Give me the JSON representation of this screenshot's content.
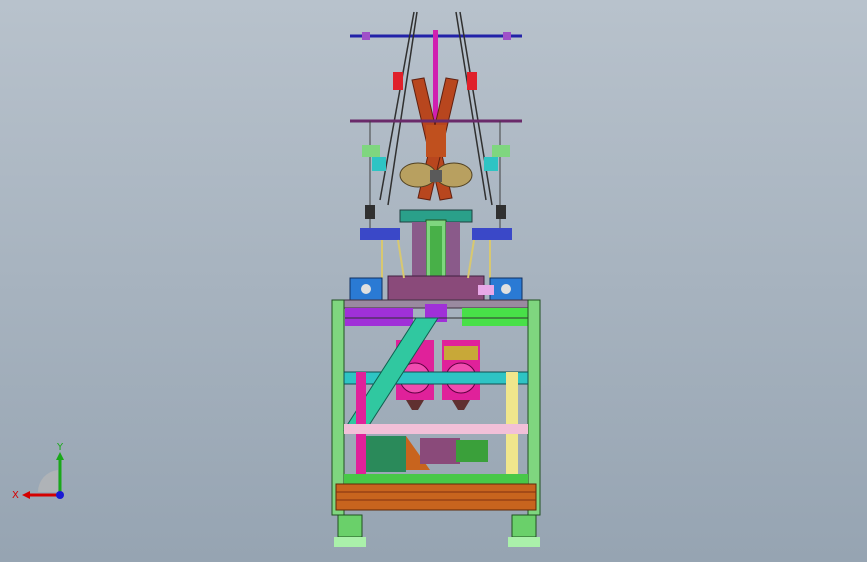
{
  "triad": {
    "x_label": "X",
    "y_label": "Y",
    "x_color": "#d40000",
    "y_color": "#1aa81a",
    "z_color": "#1a1ad4"
  },
  "colors": {
    "background_top": "#b8c2cc",
    "background_bottom": "#96a4b2",
    "frame_green": "#7fd67f",
    "purple": "#8a2be2",
    "magenta": "#e0219a",
    "cyan": "#2ec4c4",
    "yellow": "#f0e68c",
    "pink": "#f2c0d8",
    "orange": "#c8641e",
    "dark_red": "#a02020"
  }
}
